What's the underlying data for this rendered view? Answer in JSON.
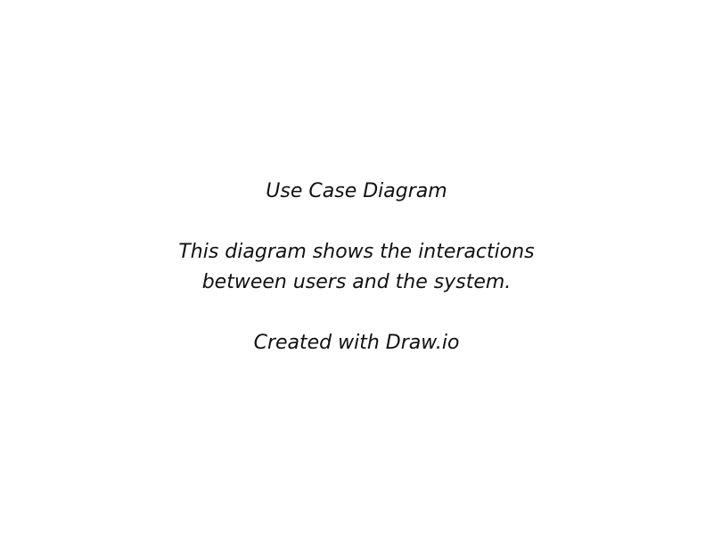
{
  "document": {
    "title": "Use Case Diagram",
    "description_lines": [
      "This diagram shows the interactions",
      "between users and the system."
    ],
    "credit": "Created with Draw.io"
  },
  "colors": {
    "background": "#ffffff",
    "text": "#111111"
  }
}
